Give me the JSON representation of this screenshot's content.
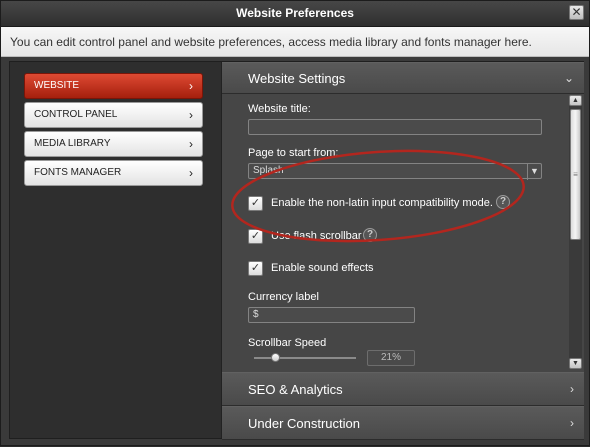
{
  "window": {
    "title": "Website Preferences",
    "close_glyph": "✕"
  },
  "info": {
    "text": "You can edit control panel and website preferences, access media library and fonts manager here."
  },
  "sidebar": {
    "items": [
      {
        "label": "WEBSITE",
        "active": true
      },
      {
        "label": "CONTROL PANEL",
        "active": false
      },
      {
        "label": "MEDIA LIBRARY",
        "active": false
      },
      {
        "label": "FONTS MANAGER",
        "active": false
      }
    ],
    "chevron": "›"
  },
  "accordion": {
    "sections": [
      {
        "label": "Website Settings",
        "expanded": true,
        "indicator": "⌄"
      },
      {
        "label": "SEO & Analytics",
        "expanded": false,
        "indicator": "›"
      },
      {
        "label": "Under Construction",
        "expanded": false,
        "indicator": "›"
      }
    ]
  },
  "settings": {
    "website_title": {
      "label": "Website title:",
      "value": ""
    },
    "start_page": {
      "label": "Page to start from:",
      "value": "Splash",
      "arrow": "▼"
    },
    "checkboxes": [
      {
        "label": "Enable the non-latin input compatibility mode.",
        "checked": true,
        "help": true
      },
      {
        "label": "Use flash scrollbar",
        "checked": true,
        "help": true
      },
      {
        "label": "Enable sound effects",
        "checked": true,
        "help": false
      }
    ],
    "check_glyph": "✓",
    "help_glyph": "?",
    "currency": {
      "label": "Currency label",
      "value": "$"
    },
    "scrollbar_speed": {
      "label": "Scrollbar Speed",
      "percent": 21,
      "display": "21%"
    }
  },
  "scrollbar": {
    "up": "▲",
    "down": "▼",
    "grip": "≡"
  },
  "colors": {
    "accent": "#c3311c",
    "annotation": "#b3261e",
    "panel": "#464646"
  }
}
